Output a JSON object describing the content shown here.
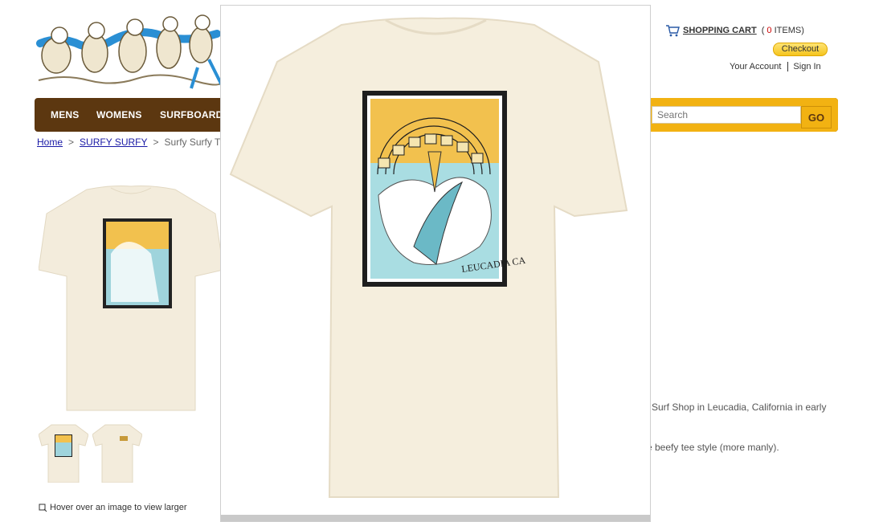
{
  "header": {
    "cart_label": "SHOPPING CART",
    "cart_count_prefix": "(",
    "cart_count": "0",
    "cart_count_suffix": "ITEMS)",
    "checkout_label": "Checkout",
    "account_label": "Your Account",
    "signin_label": "Sign In"
  },
  "nav": {
    "items": [
      "MENS",
      "WOMENS",
      "SURFBOARDS"
    ],
    "search_placeholder": "Search",
    "go_label": "GO"
  },
  "breadcrumb": {
    "home": "Home",
    "separator": ">",
    "category": "SURFY SURFY",
    "current": "Surfy Surfy Ty"
  },
  "product": {
    "hover_hint": "Hover over an image to view larger",
    "description_1": "Surf Shop in Leucadia, California in early",
    "description_2": "e beefy tee style (more manly)."
  },
  "artwork": {
    "print_text": "LEUCADIA CA"
  },
  "colors": {
    "nav_brown": "#5c3710",
    "search_yellow": "#f2b212",
    "link_blue": "#1a1aa6",
    "shirt_cream": "#f3ecdc"
  }
}
